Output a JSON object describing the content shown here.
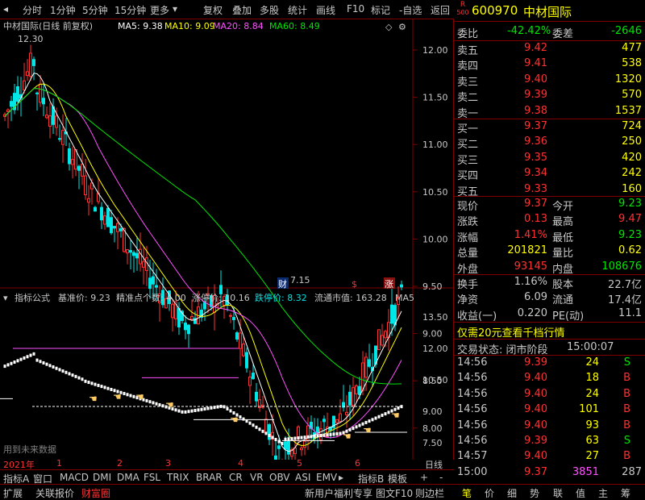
{
  "toolbar": {
    "left_items": [
      "分时",
      "1分钟",
      "5分钟",
      "15分钟",
      "更多"
    ],
    "right_items": [
      "复权",
      "叠加",
      "多股",
      "统计",
      "画线",
      "F10",
      "标记",
      "-自选",
      "返回"
    ]
  },
  "main_chart": {
    "title": "中材国际(日线 前复权)",
    "ma": [
      {
        "label": "MA5: 9.38",
        "color": "#ffffff"
      },
      {
        "label": "MA10: 9.09",
        "color": "#ffff00"
      },
      {
        "label": "MA20: 8.84",
        "color": "#ff50ff"
      },
      {
        "label": "MA60: 8.49",
        "color": "#00e600"
      }
    ],
    "high_label": "12.30",
    "low_label": "7.15",
    "y_ticks": [
      "12.00",
      "11.50",
      "11.00",
      "10.50",
      "10.00",
      "9.50",
      "9.00",
      "8.50",
      "8.00",
      "7.50"
    ],
    "markers": [
      "财",
      "$",
      "涨"
    ]
  },
  "indicator": {
    "label": "指标公式",
    "params": [
      {
        "text": "基准价: 9.23",
        "color": "#c8c8c8"
      },
      {
        "text": "精准点个数: 4.00",
        "color": "#c8c8c8"
      },
      {
        "text": "涨停价: 10.16",
        "color": "#c8c8c8"
      },
      {
        "text": "跌停价: 8.32",
        "color": "#00e6e6"
      },
      {
        "text": "流通市值: 163.28",
        "color": "#c8c8c8"
      },
      {
        "text": "MA5",
        "color": "#c8c8c8"
      }
    ],
    "y_ticks": [
      "13.50",
      "12.00",
      "10.50",
      "9.00",
      "7.50"
    ],
    "future_text": "用到未来数据"
  },
  "xaxis": {
    "year": "2021年",
    "months": [
      "1",
      "2",
      "3",
      "4",
      "5",
      "6"
    ]
  },
  "tabs1": [
    "指标A",
    "窗口",
    "MACD",
    "DMI",
    "DMA",
    "FSL",
    "TRIX",
    "BRAR",
    "CR",
    "VR",
    "OBV",
    "ASI",
    "EMV",
    "指标B",
    "模板",
    "+",
    "-"
  ],
  "xaxis_right": "日线",
  "bottom_left": [
    "扩展",
    "关联报价",
    "财富圈"
  ],
  "bottom_mid": [
    "新用户福利专享",
    "图文F10",
    "则边栏"
  ],
  "bottom_right": [
    "笔",
    "价",
    "细",
    "势",
    "联",
    "值",
    "主",
    "筹"
  ],
  "quote": {
    "code": "600970",
    "name": "中材国际",
    "badge_top": "R",
    "badge_bottom": "500",
    "weibi_label": "委比",
    "weibi_value": "-42.42%",
    "weicha_label": "委差",
    "weicha_value": "-2646",
    "sells": [
      {
        "label": "卖五",
        "price": "9.42",
        "vol": "477"
      },
      {
        "label": "卖四",
        "price": "9.41",
        "vol": "538"
      },
      {
        "label": "卖三",
        "price": "9.40",
        "vol": "1320"
      },
      {
        "label": "卖二",
        "price": "9.39",
        "vol": "570"
      },
      {
        "label": "卖一",
        "price": "9.38",
        "vol": "1537"
      }
    ],
    "buys": [
      {
        "label": "买一",
        "price": "9.37",
        "vol": "724"
      },
      {
        "label": "买二",
        "price": "9.36",
        "vol": "250"
      },
      {
        "label": "买三",
        "price": "9.35",
        "vol": "420"
      },
      {
        "label": "买四",
        "price": "9.34",
        "vol": "242"
      },
      {
        "label": "买五",
        "price": "9.33",
        "vol": "160"
      }
    ],
    "stats": [
      {
        "l1": "现价",
        "v1": "9.37",
        "c1": "red",
        "l2": "今开",
        "v2": "9.23",
        "c2": "green"
      },
      {
        "l1": "涨跌",
        "v1": "0.13",
        "c1": "red",
        "l2": "最高",
        "v2": "9.47",
        "c2": "red"
      },
      {
        "l1": "涨幅",
        "v1": "1.41%",
        "c1": "red",
        "l2": "最低",
        "v2": "9.23",
        "c2": "green"
      },
      {
        "l1": "总量",
        "v1": "201821",
        "c1": "yellow",
        "l2": "量比",
        "v2": "0.62",
        "c2": "yellow"
      },
      {
        "l1": "外盘",
        "v1": "93145",
        "c1": "red",
        "l2": "内盘",
        "v2": "108676",
        "c2": "green"
      }
    ],
    "stats2": [
      {
        "l1": "换手",
        "v1": "1.16%",
        "l2": "股本",
        "v2": "22.7亿"
      },
      {
        "l1": "净资",
        "v1": "6.09",
        "l2": "流通",
        "v2": "17.4亿"
      },
      {
        "l1": "收益(一)",
        "v1": "0.220",
        "l2": "PE(动)",
        "v2": "11.1"
      }
    ],
    "promo": "仅需20元查看千档行情",
    "status_label": "交易状态: 闭市阶段",
    "status_time": "15:00:07",
    "trades": [
      {
        "t": "14:56",
        "p": "9.39",
        "v": "24",
        "d": "S"
      },
      {
        "t": "14:56",
        "p": "9.40",
        "v": "18",
        "d": "B"
      },
      {
        "t": "14:56",
        "p": "9.40",
        "v": "24",
        "d": "B"
      },
      {
        "t": "14:56",
        "p": "9.40",
        "v": "101",
        "d": "B"
      },
      {
        "t": "14:56",
        "p": "9.40",
        "v": "93",
        "d": "B"
      },
      {
        "t": "14:56",
        "p": "9.39",
        "v": "63",
        "d": "S"
      },
      {
        "t": "14:57",
        "p": "9.40",
        "v": "27",
        "d": "B"
      },
      {
        "t": "15:00",
        "p": "9.37",
        "v": "3851",
        "d": "287"
      }
    ]
  }
}
